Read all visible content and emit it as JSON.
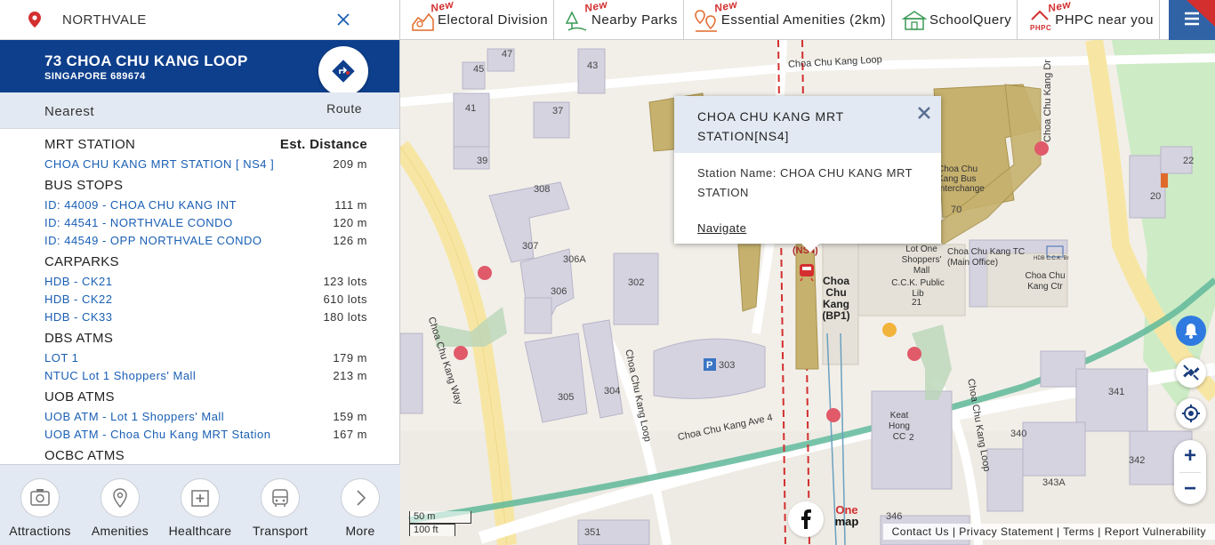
{
  "search": {
    "value": "NORTHVALE"
  },
  "address": {
    "title": "73 CHOA CHU KANG LOOP",
    "postal": "SINGAPORE 689674"
  },
  "nearest": {
    "title": "Nearest",
    "route_label": "Route",
    "sections": [
      {
        "heading": "MRT STATION",
        "dist_heading": "Est. Distance",
        "items": [
          {
            "name": "CHOA CHU KANG MRT STATION [ NS4 ]",
            "dist": "209 m"
          }
        ]
      },
      {
        "heading": "BUS STOPS",
        "dist_heading": "",
        "items": [
          {
            "name": "ID: 44009 - CHOA CHU KANG INT",
            "dist": "111 m"
          },
          {
            "name": "ID: 44541 - NORTHVALE CONDO",
            "dist": "120 m"
          },
          {
            "name": "ID: 44549 - OPP NORTHVALE CONDO",
            "dist": "126 m"
          }
        ]
      },
      {
        "heading": "CARPARKS",
        "dist_heading": "",
        "items": [
          {
            "name": "HDB - CK21",
            "dist": "123 lots"
          },
          {
            "name": "HDB - CK22",
            "dist": "610 lots"
          },
          {
            "name": "HDB - CK33",
            "dist": "180 lots"
          }
        ]
      },
      {
        "heading": "DBS ATMS",
        "dist_heading": "",
        "items": [
          {
            "name": "LOT 1",
            "dist": "179 m"
          },
          {
            "name": "NTUC Lot 1 Shoppers' Mall",
            "dist": "213 m"
          }
        ]
      },
      {
        "heading": "UOB ATMS",
        "dist_heading": "",
        "items": [
          {
            "name": "UOB ATM - Lot 1 Shoppers' Mall",
            "dist": "159 m"
          },
          {
            "name": "UOB ATM - Choa Chu Kang MRT Station",
            "dist": "167 m"
          }
        ]
      },
      {
        "heading": "OCBC ATMS",
        "dist_heading": "",
        "items": []
      }
    ]
  },
  "bottom_nav": [
    {
      "label": "Attractions",
      "icon": "camera-icon"
    },
    {
      "label": "Amenities",
      "icon": "location-pin-icon"
    },
    {
      "label": "Healthcare",
      "icon": "hospital-icon"
    },
    {
      "label": "Transport",
      "icon": "bus-icon"
    },
    {
      "label": "More",
      "icon": "chevron-right-icon"
    }
  ],
  "tabs": [
    {
      "label": "Electoral Division",
      "new": "New",
      "icon": "electoral-icon"
    },
    {
      "label": "Nearby Parks",
      "new": "New",
      "icon": "park-icon"
    },
    {
      "label": "Essential Amenities (2km)",
      "new": "New",
      "icon": "amenities-icon"
    },
    {
      "label": "SchoolQuery",
      "new": "",
      "icon": "school-icon"
    },
    {
      "label": "PHPC near you",
      "new": "New",
      "icon": "phpc-icon"
    }
  ],
  "popup": {
    "title_line1": "CHOA CHU KANG MRT",
    "title_line2": "STATION[NS4]",
    "body_line1": "Station Name: CHOA CHU KANG MRT",
    "body_line2": "STATION",
    "navigate": "Navigate"
  },
  "map_labels": {
    "road_ccl_top": "Choa Chu Kang Loop",
    "road_ccd": "Choa Chu Kang Dr",
    "road_ccw": "Choa Chu Kang Way",
    "road_ccl_mid": "Choa Chu Kang Loop",
    "road_ave4": "Choa Chu Kang Ave 4",
    "road_ccl_right": "Choa Chu Kang Loop",
    "blk_45": "45",
    "blk_47": "47",
    "blk_43": "43",
    "blk_41": "41",
    "blk_37": "37",
    "blk_39": "39",
    "blk_308": "308",
    "blk_307": "307",
    "blk_306a": "306A",
    "blk_306": "306",
    "blk_305": "305",
    "blk_304": "304",
    "blk_302": "302",
    "blk_303": "303",
    "blk_70": "70",
    "blk_20": "20",
    "blk_22": "22",
    "blk_21": "21",
    "blk_341": "341",
    "blk_340": "340",
    "blk_342": "342",
    "blk_343a": "343A",
    "blk_351": "351",
    "blk_346": "346",
    "ns4": "(NS4)",
    "station_name": "Choa Chu Kang (BP1)",
    "interchange": "Choa Chu Kang Bus Interchange",
    "lot_one": "Lot One Shoppers' Mall",
    "ccklib": "C.C.K. Public Lib",
    "tc": "Choa Chu Kang TC (Main Office)",
    "ccctr": "Choa Chu Kang Ctr",
    "hdb_br": "HDB C.C.K. Br",
    "keat_hong": "Keat Hong CC",
    "cc2": "2"
  },
  "scale": {
    "metric": "50 m",
    "imperial": "100 ft"
  },
  "footer": {
    "contact": "Contact Us",
    "privacy": "Privacy Statement",
    "terms": "Terms",
    "report": "Report Vulnerability"
  },
  "onemap": {
    "line1": "One",
    "line2": "map"
  },
  "colors": {
    "header_blue": "#0e3f8c",
    "link_blue": "#1a5fb4",
    "panel_grey": "#e3e9f2",
    "mrt_red": "#d32f2f",
    "park_green": "#cdebc5",
    "path_green": "#5fb89a",
    "building": "#c6b16e"
  }
}
